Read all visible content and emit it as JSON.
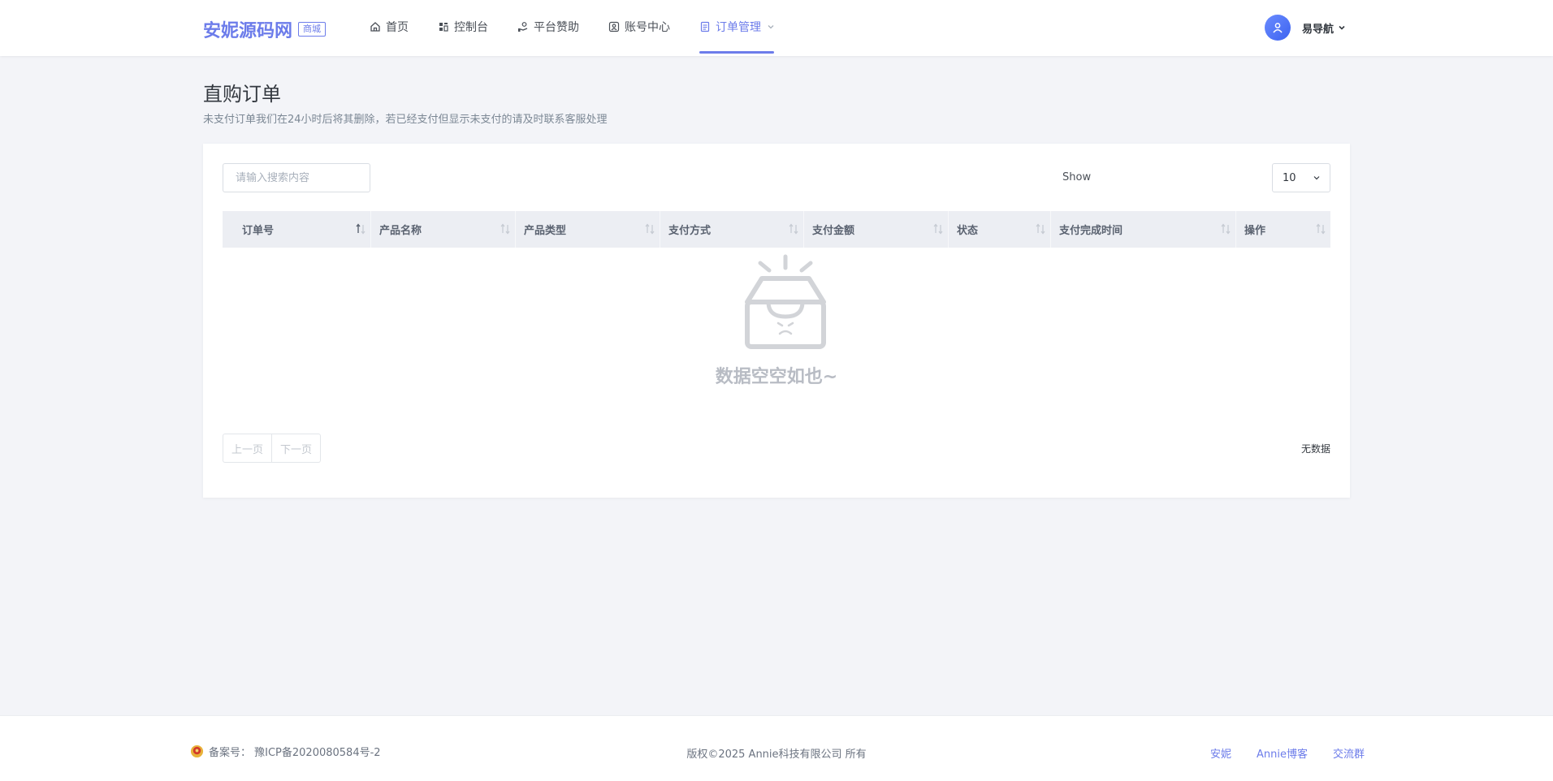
{
  "brand": {
    "name": "安妮源码网",
    "tag": "商城"
  },
  "nav": [
    {
      "label": "首页",
      "icon": "home-icon"
    },
    {
      "label": "控制台",
      "icon": "dashboard-icon"
    },
    {
      "label": "平台赞助",
      "icon": "hand-coin-icon"
    },
    {
      "label": "账号中心",
      "icon": "user-card-icon"
    },
    {
      "label": "订单管理",
      "icon": "order-list-icon",
      "active": true
    }
  ],
  "user": {
    "name": "易导航"
  },
  "page": {
    "title": "直购订单",
    "subtitle": "未支付订单我们在24小时后将其删除，若已经支付但显示未支付的请及时联系客服处理"
  },
  "table": {
    "search_placeholder": "请输入搜索内容",
    "show_label": "Show",
    "page_size": "10",
    "columns": [
      "订单号",
      "产品名称",
      "产品类型",
      "支付方式",
      "支付金额",
      "状态",
      "支付完成时间",
      "操作"
    ],
    "empty_text": "数据空空如也~",
    "prev_label": "上一页",
    "next_label": "下一页",
    "info": "无数据"
  },
  "footer": {
    "icp": "备案号： 豫ICP备2020080584号-2",
    "copyright": "版权©2025 Annie科技有限公司 所有",
    "links": [
      "安妮",
      "Annie博客",
      "交流群"
    ]
  },
  "colors": {
    "accent": "#6c7cea",
    "background": "#f3f4f8"
  }
}
